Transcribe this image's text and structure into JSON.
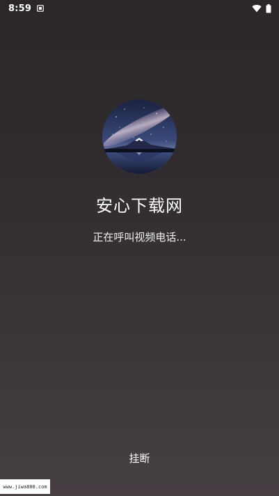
{
  "status_bar": {
    "time": "8:59",
    "icons": [
      "sim-card-icon",
      "wifi-icon",
      "battery-icon"
    ]
  },
  "caller": {
    "avatar": "mountain-night-sky-image",
    "name": "安心下载网",
    "status": "正在呼叫视频电话..."
  },
  "actions": {
    "hangup_label": "挂断"
  },
  "watermark": {
    "text": "www.jiwa800.com"
  },
  "colors": {
    "background_top": "#2b2729",
    "background_bottom": "#463f44",
    "text": "#ffffff"
  }
}
